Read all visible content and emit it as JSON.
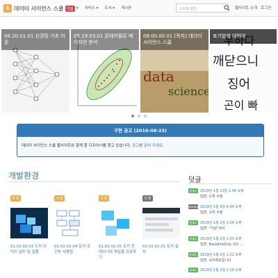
{
  "nav": {
    "brand": "데이터 사이언스 스쿨",
    "brand_badge": "개발",
    "logo_glyph": "S",
    "menu": [
      "강의 ▾",
      "서비스 ▾",
      "도서 ▾",
      "게시판"
    ],
    "search_placeholder": "노트북 검색",
    "right_links": [
      "웹사이트 소개",
      "로그인"
    ]
  },
  "carousel": {
    "slides": [
      {
        "caption": "06.20.01.01 신경망 기초 이론",
        "art": "neural-network"
      },
      {
        "caption": "05.19.03.01 몬테카를로 베이지안 분석",
        "art": "scatter"
      },
      {
        "caption": "08.00.00.01 [목차] 데이터 사이언스 스쿨",
        "art": "data-science"
      },
      {
        "caption": "표기법에 대하여",
        "art": "handwriting"
      }
    ],
    "dots": 3,
    "active_dot": 0,
    "art_text": {
      "data": "data",
      "science": "science",
      "hand": [
        "우하다",
        "깨닫으니",
        "징어",
        "곤이 빠"
      ]
    }
  },
  "notice": {
    "title": "구현 공고 (2016-08-23)",
    "body": "데이터 사이언스 스쿨 웹사이트와 함께 할 디자이너를 찾고 있습니다.",
    "link": "공고를 읽어 주세요."
  },
  "section": {
    "title": "개발환경",
    "cards": [
      {
        "tag": "8 장",
        "title": "01.02.02.03 도커 이미지 설치 및 실행",
        "tag_color": "#f0ad4e"
      },
      {
        "tag": "4 장",
        "title": "01.02.02.04 도커 조건부 사용법",
        "tag_color": "#f0ad4e"
      },
      {
        "tag": "4 장",
        "title": "01.02.02.05 도커 컨테이너와 파일을 공유하기",
        "tag_color": "#f0ad4e"
      },
      {
        "tag": "9 장",
        "title": "01.02.02.01 도커 설치",
        "tag_color": "#777777"
      }
    ]
  },
  "comments": {
    "title": "덧글",
    "items": [
      {
        "badge": "손테스",
        "line1": "2019년 1월 10일 1:06 오후",
        "line2": "답변: 오류 수정",
        "color": "#5cb85c"
      },
      {
        "badge": "deargolf",
        "line1": "2019년 1월 9일 4:44 오후",
        "line2": "답변: 오류 수정",
        "color": "#777777"
      },
      {
        "badge": "손테스",
        "line1": "2019년 1월 2일 1:26 오후",
        "line2": "답변: \"가설\"에서",
        "color": "#5cb85c"
      },
      {
        "badge": "손테스",
        "line1": "2019년 1월 2일 1:23 오후",
        "line2": "답변: BaselineOnly 코드 ...",
        "color": "#5cb85c"
      },
      {
        "badge": "손테스",
        "line1": "2019년 1월 2일 1:22 오후",
        "line2": "답변: 오타제보입니다",
        "color": "#5cb85c"
      },
      {
        "badge": "손테스",
        "line1": "2019년 1월 2일 1:18 오후",
        "line2": "",
        "color": "#5cb85c"
      }
    ]
  }
}
